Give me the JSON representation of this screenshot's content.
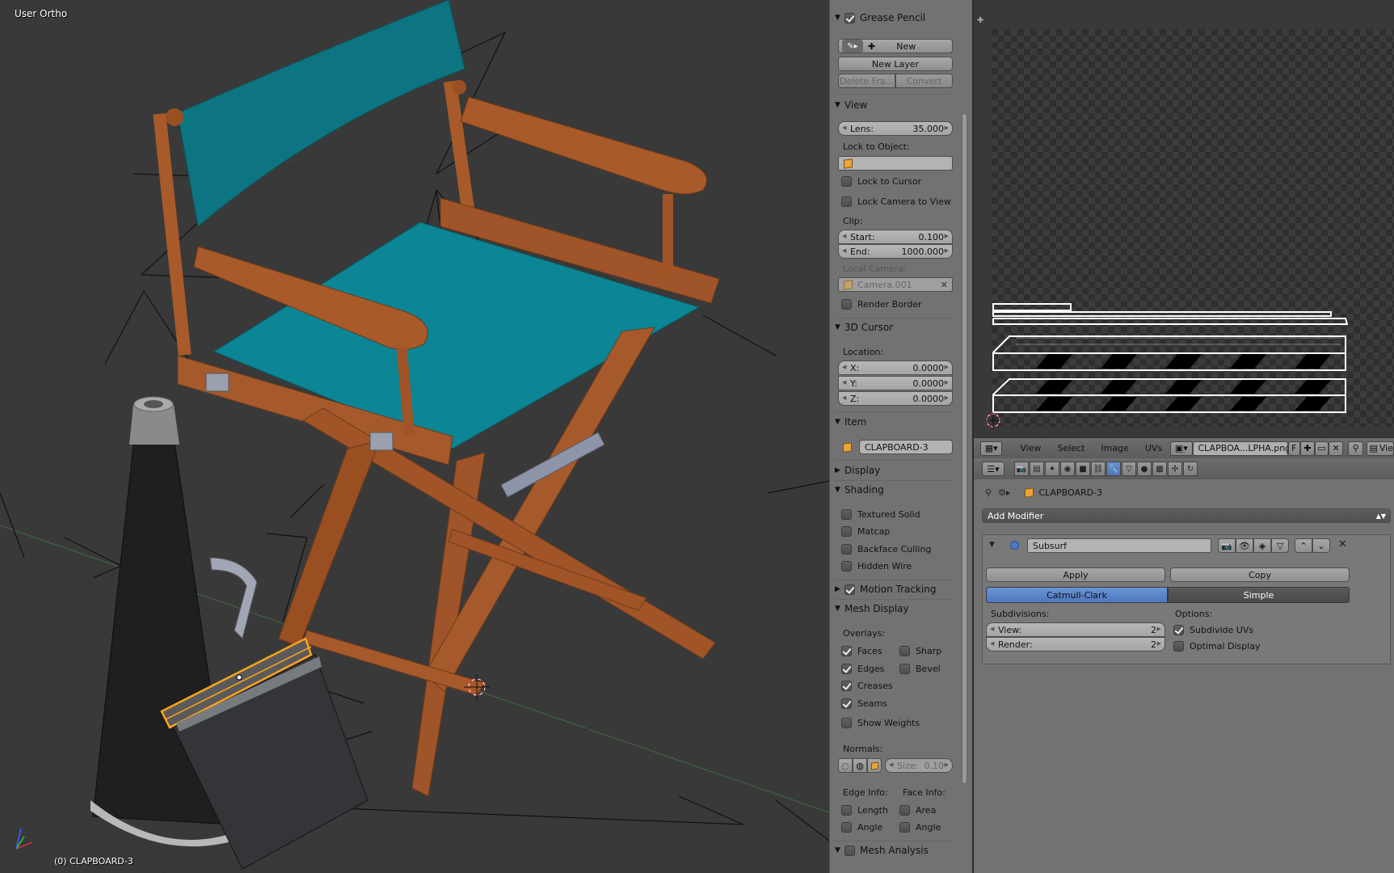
{
  "viewport": {
    "view_name": "User Ortho",
    "object_status": "(0) CLAPBOARD-3"
  },
  "npanel": {
    "grease_pencil": {
      "title": "Grease Pencil",
      "enabled": true,
      "new_label": "New",
      "new_layer_label": "New Layer",
      "delete_frame_label": "Delete Fra...",
      "convert_label": "Convert"
    },
    "view": {
      "title": "View",
      "lens_label": "Lens:",
      "lens_value": "35.000",
      "lock_to_object_label": "Lock to Object:",
      "lock_to_cursor_label": "Lock to Cursor",
      "lock_camera_label": "Lock Camera to View",
      "clip_label": "Clip:",
      "clip_start_label": "Start:",
      "clip_start_value": "0.100",
      "clip_end_label": "End:",
      "clip_end_value": "1000.000",
      "local_camera_label": "Local Camera:",
      "local_camera_value": "Camera.001",
      "render_border_label": "Render Border"
    },
    "cursor": {
      "title": "3D Cursor",
      "location_label": "Location:",
      "x_label": "X:",
      "x_value": "0.0000",
      "y_label": "Y:",
      "y_value": "0.0000",
      "z_label": "Z:",
      "z_value": "0.0000"
    },
    "item": {
      "title": "Item",
      "name": "CLAPBOARD-3"
    },
    "display": {
      "title": "Display"
    },
    "shading": {
      "title": "Shading",
      "textured_solid": "Textured Solid",
      "matcap": "Matcap",
      "backface_culling": "Backface Culling",
      "hidden_wire": "Hidden Wire"
    },
    "motion_tracking": {
      "title": "Motion Tracking",
      "enabled": true
    },
    "mesh_display": {
      "title": "Mesh Display",
      "overlays_label": "Overlays:",
      "faces": "Faces",
      "sharp": "Sharp",
      "edges": "Edges",
      "bevel": "Bevel",
      "creases": "Creases",
      "seams": "Seams",
      "show_weights": "Show Weights",
      "normals_label": "Normals:",
      "size_label": "Size:",
      "size_value": "0.10",
      "edge_info_label": "Edge Info:",
      "face_info_label": "Face Info:",
      "length": "Length",
      "area": "Area",
      "angle_edge": "Angle",
      "angle_face": "Angle"
    },
    "mesh_analysis": {
      "title": "Mesh Analysis"
    }
  },
  "uv_editor": {
    "header": {
      "view": "View",
      "select": "Select",
      "image": "Image",
      "uvs": "UVs",
      "image_name": "CLAPBOA...LPHA.png",
      "fake_user": "F",
      "view_mode": "Vie"
    }
  },
  "properties": {
    "breadcrumb_object": "CLAPBOARD-3",
    "add_modifier_label": "Add Modifier",
    "modifier": {
      "name": "Subsurf",
      "apply_label": "Apply",
      "copy_label": "Copy",
      "catmull_clark_label": "Catmull-Clark",
      "simple_label": "Simple",
      "subdivisions_label": "Subdivisions:",
      "view_label": "View:",
      "view_value": "2",
      "render_label": "Render:",
      "render_value": "2",
      "options_label": "Options:",
      "subdivide_uvs_label": "Subdivide UVs",
      "optimal_display_label": "Optimal Display"
    }
  },
  "colors": {
    "wood": "#a0522d",
    "canvas_teal": "#0e7f8c",
    "selection_orange": "#ffa21a",
    "active_blue": "#5680c2",
    "viewport_bg": "#393939",
    "panel_bg": "#727272"
  }
}
